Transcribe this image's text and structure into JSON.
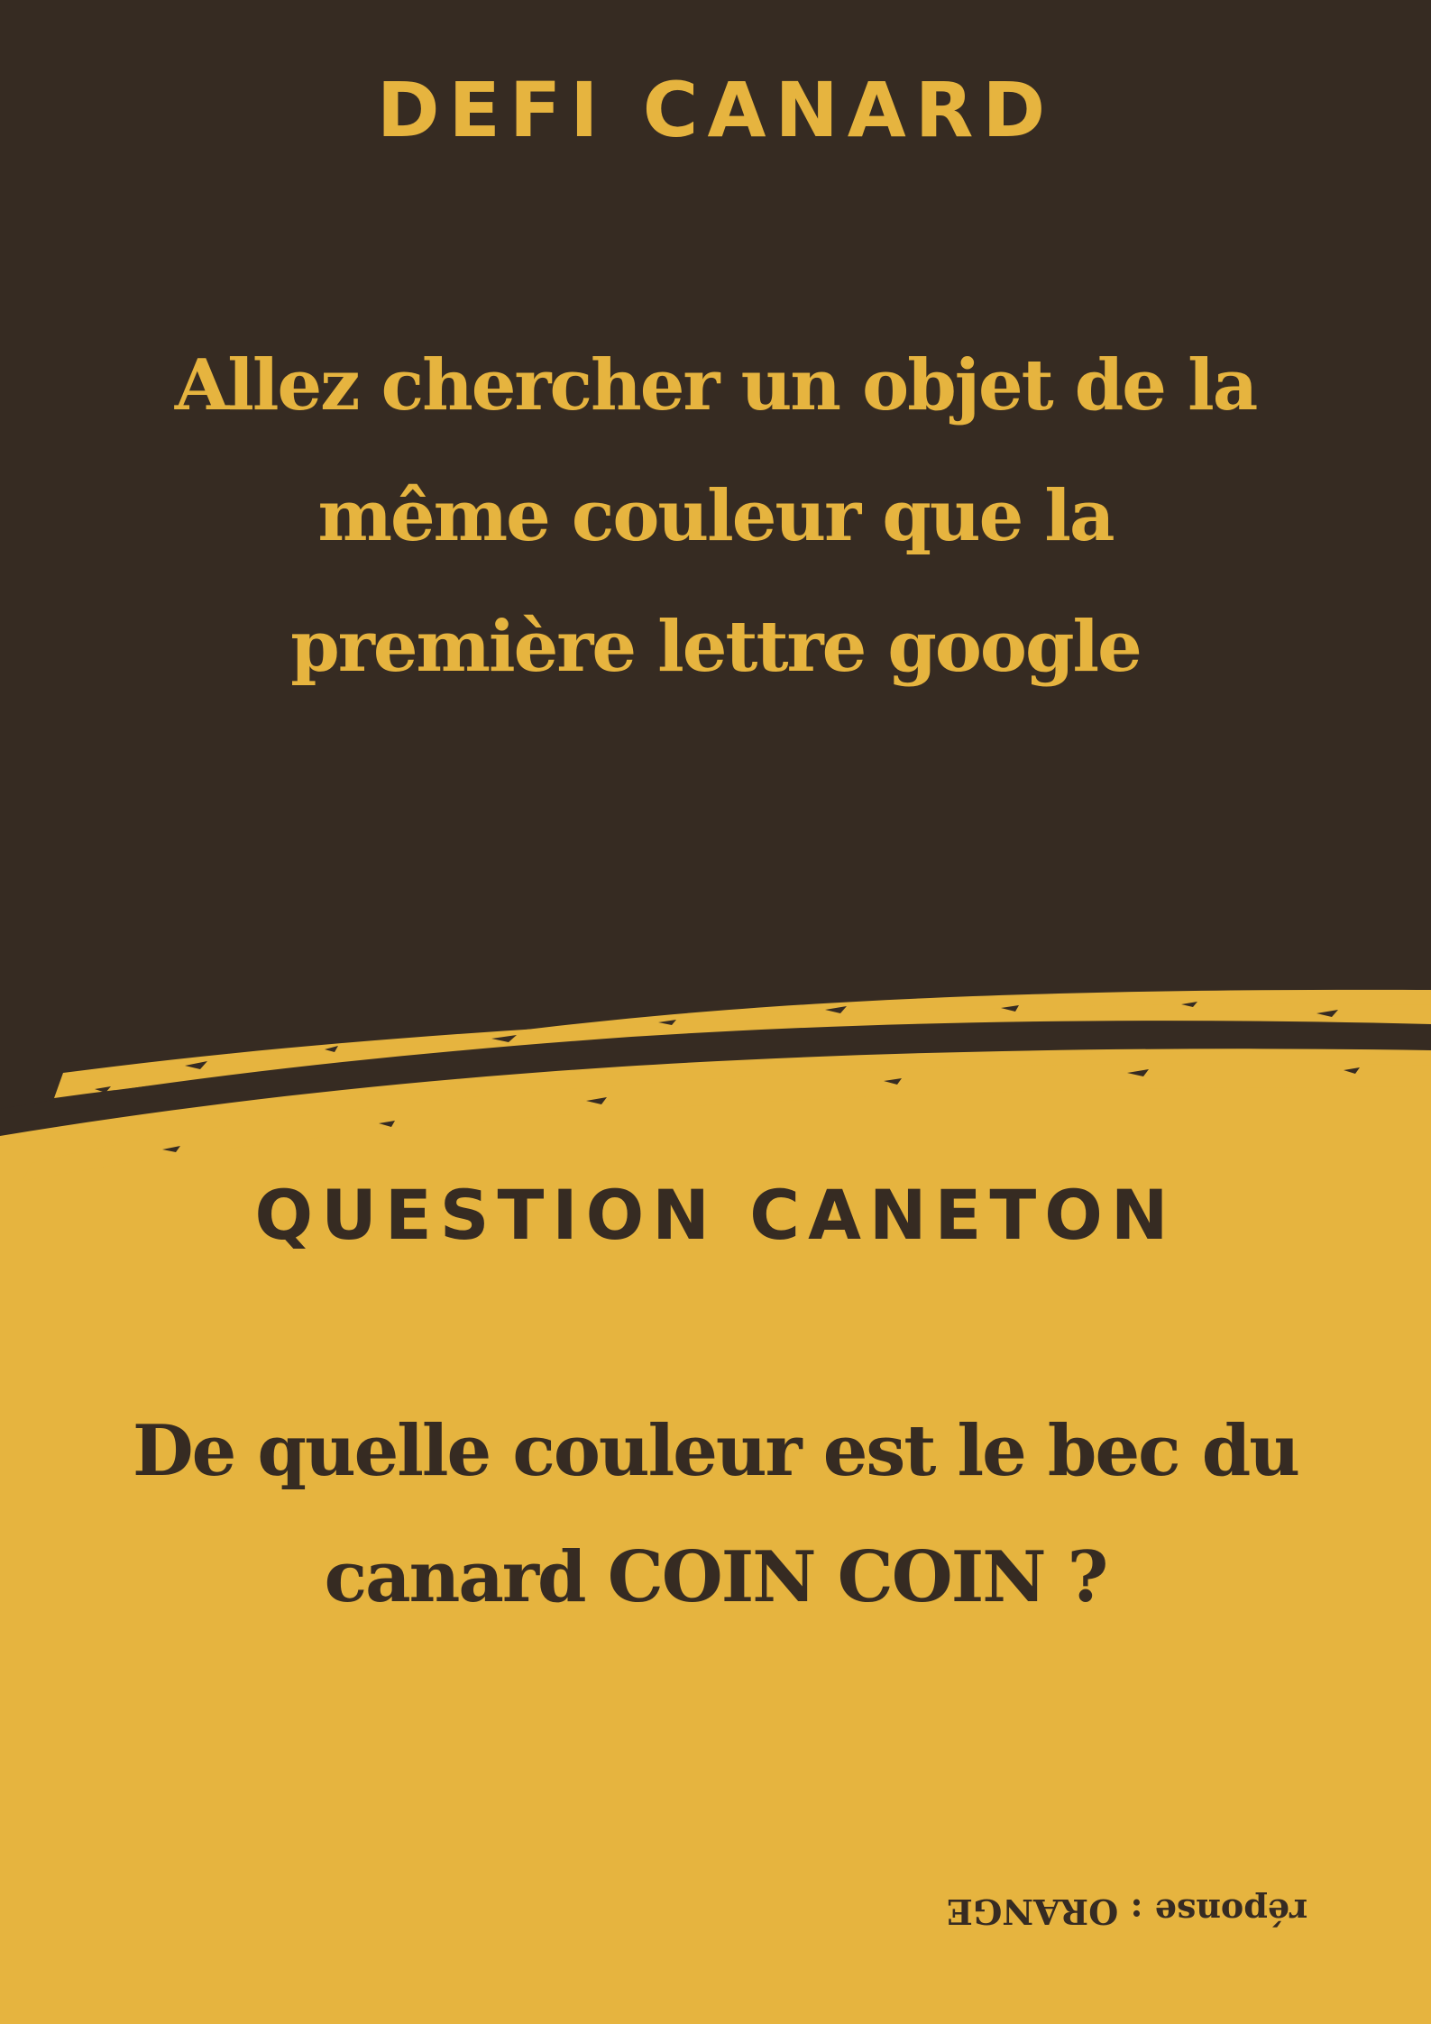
{
  "card": {
    "challenge_label": "DEFI CANARD",
    "challenge_text": "Allez chercher un objet de la\nmême couleur que la\npremière lettre google",
    "question_label": "QUESTION CANETON",
    "question_text": "De quelle couleur est le bec du\ncanard COIN COIN ?",
    "answer_text": "réponse : ORANGE"
  },
  "colors": {
    "dark": "#362b22",
    "gold": "#e6b43f"
  }
}
